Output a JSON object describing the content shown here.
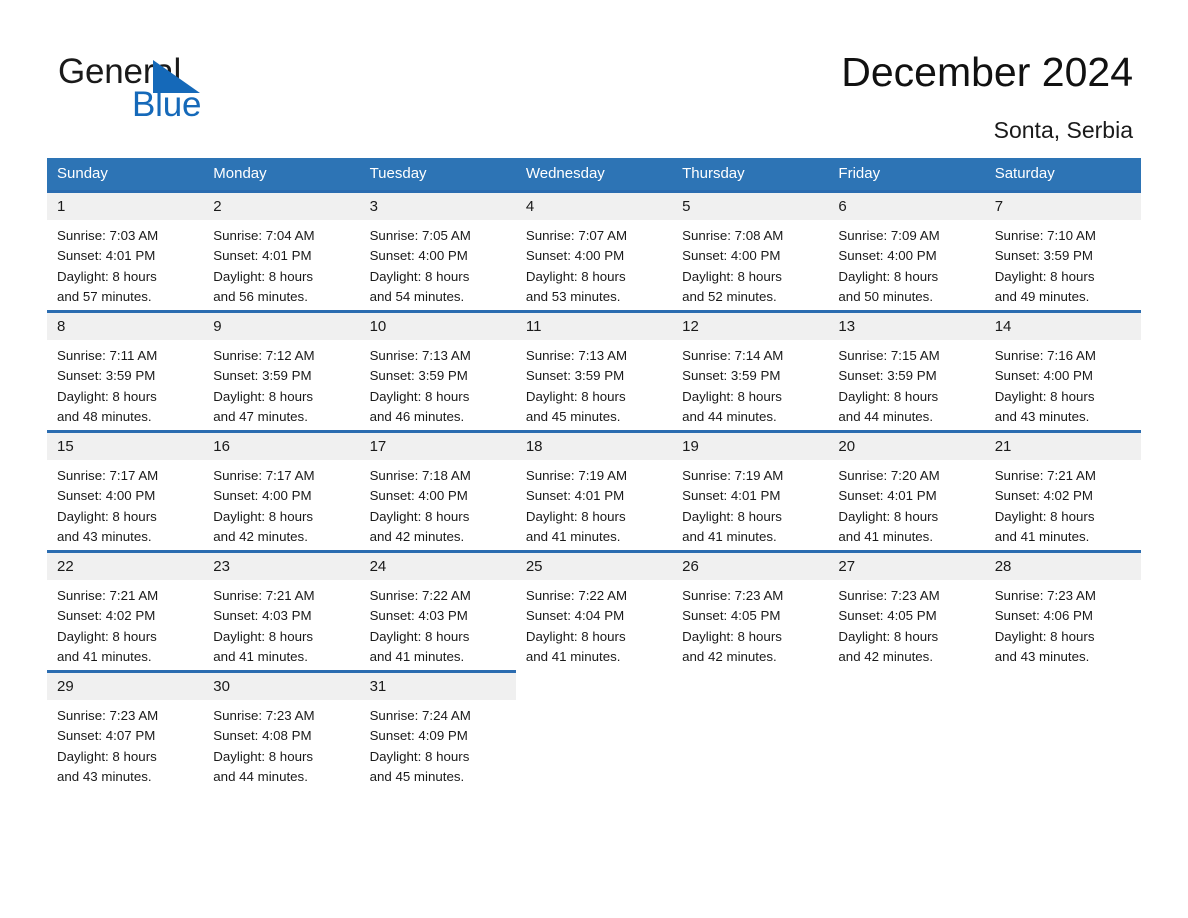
{
  "logo": {
    "word1": "General",
    "word2": "Blue",
    "triangle_color": "#1569b9",
    "text_color": "#1a1a1a"
  },
  "header": {
    "title": "December 2024",
    "location": "Sonta, Serbia"
  },
  "colors": {
    "header_blue": "#2d74b5",
    "row_rule_blue": "#2b6cb0",
    "daynum_band": "#f0f0f0",
    "text": "#1a1a1a"
  },
  "calendar": {
    "weekday_headers": [
      "Sunday",
      "Monday",
      "Tuesday",
      "Wednesday",
      "Thursday",
      "Friday",
      "Saturday"
    ],
    "weeks": [
      [
        {
          "day": "1",
          "info": "Sunrise: 7:03 AM\nSunset: 4:01 PM\nDaylight: 8 hours\nand 57 minutes."
        },
        {
          "day": "2",
          "info": "Sunrise: 7:04 AM\nSunset: 4:01 PM\nDaylight: 8 hours\nand 56 minutes."
        },
        {
          "day": "3",
          "info": "Sunrise: 7:05 AM\nSunset: 4:00 PM\nDaylight: 8 hours\nand 54 minutes."
        },
        {
          "day": "4",
          "info": "Sunrise: 7:07 AM\nSunset: 4:00 PM\nDaylight: 8 hours\nand 53 minutes."
        },
        {
          "day": "5",
          "info": "Sunrise: 7:08 AM\nSunset: 4:00 PM\nDaylight: 8 hours\nand 52 minutes."
        },
        {
          "day": "6",
          "info": "Sunrise: 7:09 AM\nSunset: 4:00 PM\nDaylight: 8 hours\nand 50 minutes."
        },
        {
          "day": "7",
          "info": "Sunrise: 7:10 AM\nSunset: 3:59 PM\nDaylight: 8 hours\nand 49 minutes."
        }
      ],
      [
        {
          "day": "8",
          "info": "Sunrise: 7:11 AM\nSunset: 3:59 PM\nDaylight: 8 hours\nand 48 minutes."
        },
        {
          "day": "9",
          "info": "Sunrise: 7:12 AM\nSunset: 3:59 PM\nDaylight: 8 hours\nand 47 minutes."
        },
        {
          "day": "10",
          "info": "Sunrise: 7:13 AM\nSunset: 3:59 PM\nDaylight: 8 hours\nand 46 minutes."
        },
        {
          "day": "11",
          "info": "Sunrise: 7:13 AM\nSunset: 3:59 PM\nDaylight: 8 hours\nand 45 minutes."
        },
        {
          "day": "12",
          "info": "Sunrise: 7:14 AM\nSunset: 3:59 PM\nDaylight: 8 hours\nand 44 minutes."
        },
        {
          "day": "13",
          "info": "Sunrise: 7:15 AM\nSunset: 3:59 PM\nDaylight: 8 hours\nand 44 minutes."
        },
        {
          "day": "14",
          "info": "Sunrise: 7:16 AM\nSunset: 4:00 PM\nDaylight: 8 hours\nand 43 minutes."
        }
      ],
      [
        {
          "day": "15",
          "info": "Sunrise: 7:17 AM\nSunset: 4:00 PM\nDaylight: 8 hours\nand 43 minutes."
        },
        {
          "day": "16",
          "info": "Sunrise: 7:17 AM\nSunset: 4:00 PM\nDaylight: 8 hours\nand 42 minutes."
        },
        {
          "day": "17",
          "info": "Sunrise: 7:18 AM\nSunset: 4:00 PM\nDaylight: 8 hours\nand 42 minutes."
        },
        {
          "day": "18",
          "info": "Sunrise: 7:19 AM\nSunset: 4:01 PM\nDaylight: 8 hours\nand 41 minutes."
        },
        {
          "day": "19",
          "info": "Sunrise: 7:19 AM\nSunset: 4:01 PM\nDaylight: 8 hours\nand 41 minutes."
        },
        {
          "day": "20",
          "info": "Sunrise: 7:20 AM\nSunset: 4:01 PM\nDaylight: 8 hours\nand 41 minutes."
        },
        {
          "day": "21",
          "info": "Sunrise: 7:21 AM\nSunset: 4:02 PM\nDaylight: 8 hours\nand 41 minutes."
        }
      ],
      [
        {
          "day": "22",
          "info": "Sunrise: 7:21 AM\nSunset: 4:02 PM\nDaylight: 8 hours\nand 41 minutes."
        },
        {
          "day": "23",
          "info": "Sunrise: 7:21 AM\nSunset: 4:03 PM\nDaylight: 8 hours\nand 41 minutes."
        },
        {
          "day": "24",
          "info": "Sunrise: 7:22 AM\nSunset: 4:03 PM\nDaylight: 8 hours\nand 41 minutes."
        },
        {
          "day": "25",
          "info": "Sunrise: 7:22 AM\nSunset: 4:04 PM\nDaylight: 8 hours\nand 41 minutes."
        },
        {
          "day": "26",
          "info": "Sunrise: 7:23 AM\nSunset: 4:05 PM\nDaylight: 8 hours\nand 42 minutes."
        },
        {
          "day": "27",
          "info": "Sunrise: 7:23 AM\nSunset: 4:05 PM\nDaylight: 8 hours\nand 42 minutes."
        },
        {
          "day": "28",
          "info": "Sunrise: 7:23 AM\nSunset: 4:06 PM\nDaylight: 8 hours\nand 43 minutes."
        }
      ],
      [
        {
          "day": "29",
          "info": "Sunrise: 7:23 AM\nSunset: 4:07 PM\nDaylight: 8 hours\nand 43 minutes."
        },
        {
          "day": "30",
          "info": "Sunrise: 7:23 AM\nSunset: 4:08 PM\nDaylight: 8 hours\nand 44 minutes."
        },
        {
          "day": "31",
          "info": "Sunrise: 7:24 AM\nSunset: 4:09 PM\nDaylight: 8 hours\nand 45 minutes."
        },
        {
          "day": "",
          "info": ""
        },
        {
          "day": "",
          "info": ""
        },
        {
          "day": "",
          "info": ""
        },
        {
          "day": "",
          "info": ""
        }
      ]
    ]
  }
}
